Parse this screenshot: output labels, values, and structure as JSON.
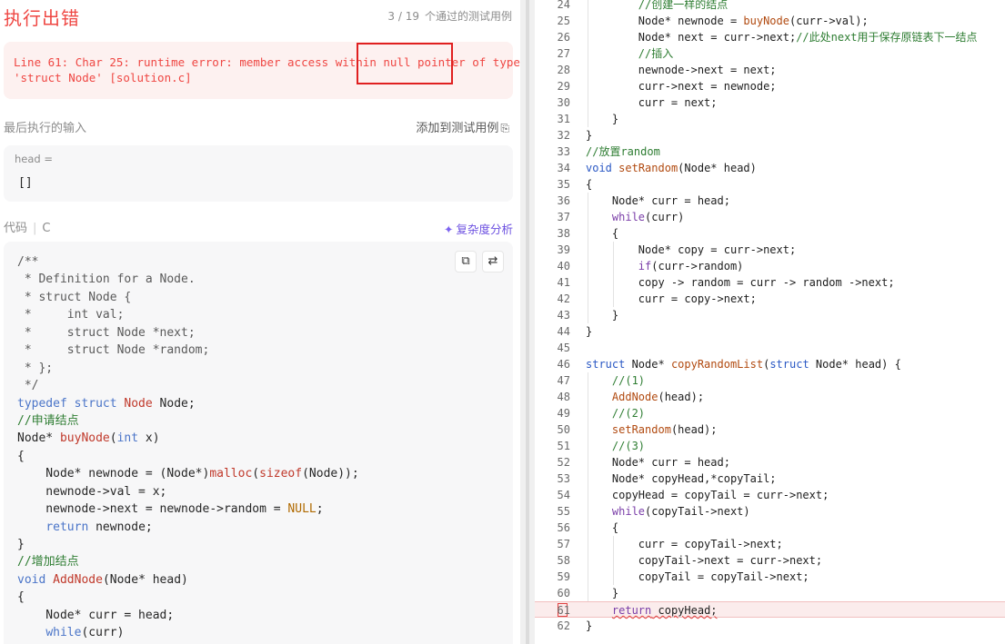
{
  "left": {
    "title": "执行出错",
    "pass_count": "3 / 19",
    "pass_label": "个通过的测试用例",
    "error_message_line1": "Line 61: Char 25: runtime error: member access within null pointer of type",
    "error_message_line2": "'struct Node' [solution.c]",
    "last_input_label": "最后执行的输入",
    "add_testcase": "添加到测试用例",
    "input_var": "head =",
    "input_value": "[]",
    "code_label": "代码",
    "code_lang": "C",
    "complexity": "复杂度分析"
  },
  "left_code": [
    [
      {
        "t": "/**",
        "c": "ldoc"
      }
    ],
    [
      {
        "t": " * Definition for a Node.",
        "c": "ldoc"
      }
    ],
    [
      {
        "t": " * struct Node {",
        "c": "ldoc"
      }
    ],
    [
      {
        "t": " *     int val;",
        "c": "ldoc"
      }
    ],
    [
      {
        "t": " *     struct Node *next;",
        "c": "ldoc"
      }
    ],
    [
      {
        "t": " *     struct Node *random;",
        "c": "ldoc"
      }
    ],
    [
      {
        "t": " * };",
        "c": "ldoc"
      }
    ],
    [
      {
        "t": " */",
        "c": "ldoc"
      }
    ],
    [
      {
        "t": "typedef struct ",
        "c": "lkw"
      },
      {
        "t": "Node",
        "c": "lty"
      },
      {
        "t": " Node;",
        "c": ""
      }
    ],
    [
      {
        "t": "//申请结点",
        "c": "lcm"
      }
    ],
    [
      {
        "t": "Node* ",
        "c": ""
      },
      {
        "t": "buyNode",
        "c": "lfn"
      },
      {
        "t": "(",
        "c": ""
      },
      {
        "t": "int",
        "c": "lkw"
      },
      {
        "t": " x)",
        "c": ""
      }
    ],
    [
      {
        "t": "{",
        "c": ""
      }
    ],
    [
      {
        "t": "    Node* newnode = (Node*)",
        "c": ""
      },
      {
        "t": "malloc",
        "c": "lfn"
      },
      {
        "t": "(",
        "c": ""
      },
      {
        "t": "sizeof",
        "c": "lfn"
      },
      {
        "t": "(Node));",
        "c": ""
      }
    ],
    [
      {
        "t": "    newnode->val = x;",
        "c": ""
      }
    ],
    [
      {
        "t": "    newnode->next = newnode->random = ",
        "c": ""
      },
      {
        "t": "NULL",
        "c": "lnull"
      },
      {
        "t": ";",
        "c": ""
      }
    ],
    [
      {
        "t": "    ",
        "c": ""
      },
      {
        "t": "return",
        "c": "lkw"
      },
      {
        "t": " newnode;",
        "c": ""
      }
    ],
    [
      {
        "t": "}",
        "c": ""
      }
    ],
    [
      {
        "t": "//增加结点",
        "c": "lcm"
      }
    ],
    [
      {
        "t": "void ",
        "c": "lkw"
      },
      {
        "t": "AddNode",
        "c": "lfn"
      },
      {
        "t": "(Node* head)",
        "c": ""
      }
    ],
    [
      {
        "t": "{",
        "c": ""
      }
    ],
    [
      {
        "t": "    Node* curr = head;",
        "c": ""
      }
    ],
    [
      {
        "t": "    ",
        "c": ""
      },
      {
        "t": "while",
        "c": "lkw"
      },
      {
        "t": "(curr)",
        "c": ""
      }
    ]
  ],
  "right_code": [
    {
      "n": "24",
      "s": [
        {
          "t": "        //创建一样的结点",
          "c": "cm"
        }
      ]
    },
    {
      "n": "25",
      "s": [
        {
          "t": "        Node* newnode = ",
          "c": ""
        },
        {
          "t": "buyNode",
          "c": "fn"
        },
        {
          "t": "(curr->val);",
          "c": ""
        }
      ]
    },
    {
      "n": "26",
      "s": [
        {
          "t": "        Node* next = curr->next;",
          "c": ""
        },
        {
          "t": "//此处next用于保存原链表下一结点",
          "c": "cm"
        }
      ]
    },
    {
      "n": "27",
      "s": [
        {
          "t": "        //插入",
          "c": "cm"
        }
      ]
    },
    {
      "n": "28",
      "s": [
        {
          "t": "        newnode->next = next;",
          "c": ""
        }
      ]
    },
    {
      "n": "29",
      "s": [
        {
          "t": "        curr->next = newnode;",
          "c": ""
        }
      ]
    },
    {
      "n": "30",
      "s": [
        {
          "t": "        curr = next;",
          "c": ""
        }
      ]
    },
    {
      "n": "31",
      "s": [
        {
          "t": "    }",
          "c": ""
        }
      ]
    },
    {
      "n": "32",
      "s": [
        {
          "t": "}",
          "c": ""
        }
      ]
    },
    {
      "n": "33",
      "s": [
        {
          "t": "//放置random",
          "c": "cm"
        }
      ]
    },
    {
      "n": "34",
      "s": [
        {
          "t": "void",
          "c": "kwb"
        },
        {
          "t": " ",
          "c": ""
        },
        {
          "t": "setRandom",
          "c": "fn"
        },
        {
          "t": "(Node* head)",
          "c": ""
        }
      ]
    },
    {
      "n": "35",
      "s": [
        {
          "t": "{",
          "c": ""
        }
      ]
    },
    {
      "n": "36",
      "s": [
        {
          "t": "    Node* curr = head;",
          "c": ""
        }
      ]
    },
    {
      "n": "37",
      "s": [
        {
          "t": "    ",
          "c": ""
        },
        {
          "t": "while",
          "c": "kw"
        },
        {
          "t": "(curr)",
          "c": ""
        }
      ]
    },
    {
      "n": "38",
      "s": [
        {
          "t": "    {",
          "c": ""
        }
      ]
    },
    {
      "n": "39",
      "s": [
        {
          "t": "        Node* copy = curr->next;",
          "c": ""
        }
      ]
    },
    {
      "n": "40",
      "s": [
        {
          "t": "        ",
          "c": ""
        },
        {
          "t": "if",
          "c": "kw"
        },
        {
          "t": "(curr->random)",
          "c": ""
        }
      ]
    },
    {
      "n": "41",
      "s": [
        {
          "t": "        copy -> random = curr -> random ->next;",
          "c": ""
        }
      ]
    },
    {
      "n": "42",
      "s": [
        {
          "t": "        curr = copy->next;",
          "c": ""
        }
      ]
    },
    {
      "n": "43",
      "s": [
        {
          "t": "    }",
          "c": ""
        }
      ]
    },
    {
      "n": "44",
      "s": [
        {
          "t": "}",
          "c": ""
        }
      ]
    },
    {
      "n": "45",
      "s": []
    },
    {
      "n": "46",
      "s": [
        {
          "t": "struct",
          "c": "kwb"
        },
        {
          "t": " Node* ",
          "c": ""
        },
        {
          "t": "copyRandomList",
          "c": "fn"
        },
        {
          "t": "(",
          "c": ""
        },
        {
          "t": "struct",
          "c": "kwb"
        },
        {
          "t": " Node* head) {",
          "c": ""
        }
      ]
    },
    {
      "n": "47",
      "s": [
        {
          "t": "    //(1)",
          "c": "cm"
        }
      ]
    },
    {
      "n": "48",
      "s": [
        {
          "t": "    ",
          "c": ""
        },
        {
          "t": "AddNode",
          "c": "fn"
        },
        {
          "t": "(head);",
          "c": ""
        }
      ]
    },
    {
      "n": "49",
      "s": [
        {
          "t": "    //(2)",
          "c": "cm"
        }
      ]
    },
    {
      "n": "50",
      "s": [
        {
          "t": "    ",
          "c": ""
        },
        {
          "t": "setRandom",
          "c": "fn"
        },
        {
          "t": "(head);",
          "c": ""
        }
      ]
    },
    {
      "n": "51",
      "s": [
        {
          "t": "    //(3)",
          "c": "cm"
        }
      ]
    },
    {
      "n": "52",
      "s": [
        {
          "t": "    Node* curr = head;",
          "c": ""
        }
      ]
    },
    {
      "n": "53",
      "s": [
        {
          "t": "    Node* copyHead,*copyTail;",
          "c": ""
        }
      ]
    },
    {
      "n": "54",
      "s": [
        {
          "t": "    copyHead = copyTail = curr->next;",
          "c": ""
        }
      ]
    },
    {
      "n": "55",
      "s": [
        {
          "t": "    ",
          "c": ""
        },
        {
          "t": "while",
          "c": "kw"
        },
        {
          "t": "(copyTail->next)",
          "c": ""
        }
      ]
    },
    {
      "n": "56",
      "s": [
        {
          "t": "    {",
          "c": ""
        }
      ]
    },
    {
      "n": "57",
      "s": [
        {
          "t": "        curr = copyTail->next;",
          "c": ""
        }
      ]
    },
    {
      "n": "58",
      "s": [
        {
          "t": "        copyTail->next = curr->next;",
          "c": ""
        }
      ]
    },
    {
      "n": "59",
      "s": [
        {
          "t": "        copyTail = copyTail->next;",
          "c": ""
        }
      ]
    },
    {
      "n": "60",
      "s": [
        {
          "t": "    }",
          "c": ""
        }
      ]
    },
    {
      "n": "61",
      "err": true,
      "s": [
        {
          "t": "    ",
          "c": ""
        },
        {
          "t": "return",
          "c": "kw squiggle"
        },
        {
          "t": " ",
          "c": "squiggle"
        },
        {
          "t": "copyHead;",
          "c": "squiggle"
        }
      ]
    },
    {
      "n": "62",
      "s": [
        {
          "t": "}",
          "c": ""
        }
      ]
    }
  ],
  "colors": {
    "error_red": "#ef4743",
    "error_bg": "#fdf1f0",
    "accent_purple": "#6b4fe0",
    "panel_bg": "#f7f7f8"
  }
}
